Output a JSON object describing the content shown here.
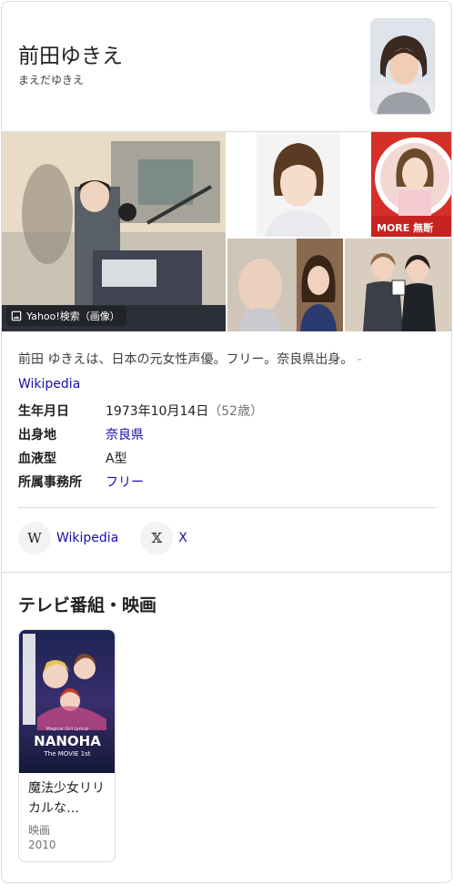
{
  "header": {
    "title": "前田ゆきえ",
    "subtitle": "まえだゆきえ"
  },
  "images": {
    "badge_label": "Yahoo!検索（画像）"
  },
  "description": {
    "text": "前田 ゆきえは、日本の元女性声優。フリー。奈良県出身。",
    "separator": "-",
    "source": "Wikipedia"
  },
  "facts": [
    {
      "key": "生年月日",
      "value": "1973年10月14日",
      "extra": "（52歳）"
    },
    {
      "key": "出身地",
      "value": "奈良県"
    },
    {
      "key": "血液型",
      "value": "A型"
    },
    {
      "key": "所属事務所",
      "value": "フリー"
    }
  ],
  "profiles": [
    {
      "label": "Wikipedia",
      "icon_text": "W",
      "icon": "wikipedia-icon"
    },
    {
      "label": "X",
      "icon_text": "𝕏",
      "icon": "x-icon"
    }
  ],
  "tv_section": {
    "title": "テレビ番組・映画",
    "items": [
      {
        "title": "魔法少女リリカルな…",
        "type": "映画",
        "year": "2010",
        "poster_text_main": "NANOHA",
        "poster_text_sub": "The MOVIE 1st",
        "poster_text_top": "Magical Girl Lyrical"
      }
    ]
  },
  "colors": {
    "link": "#1a0dab",
    "border": "#dadce0",
    "text": "#202124",
    "muted": "#70757a"
  }
}
